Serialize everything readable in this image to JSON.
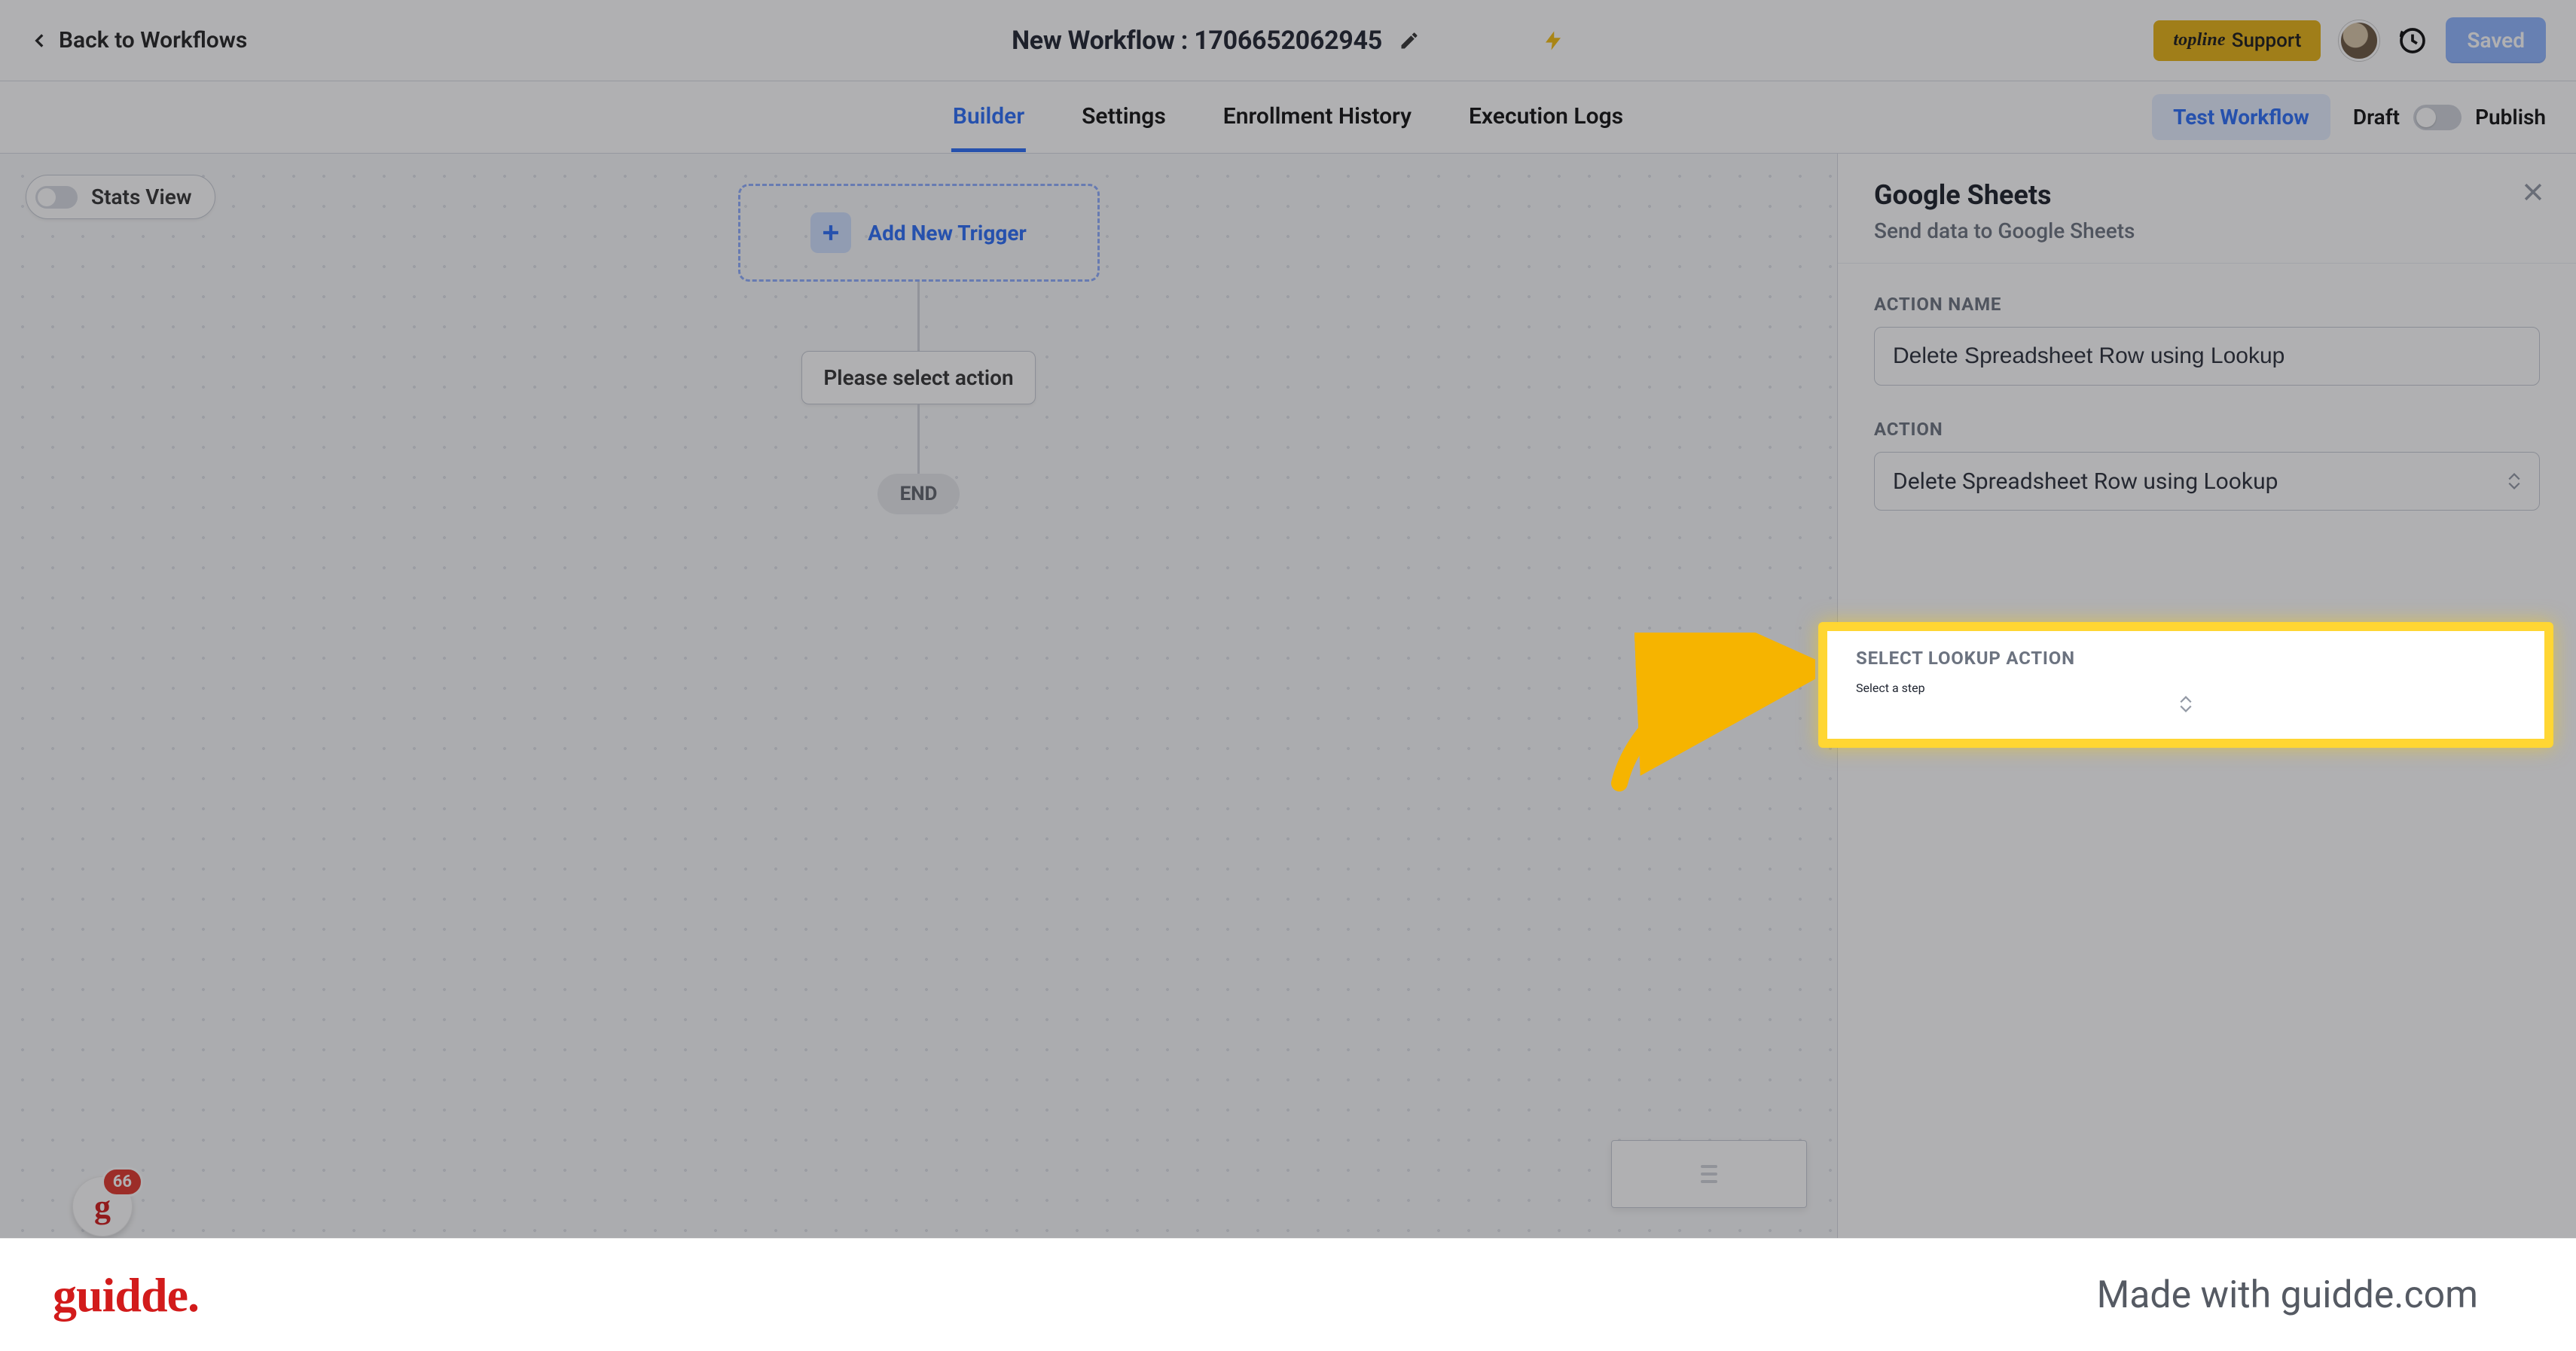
{
  "header": {
    "back_label": "Back to Workflows",
    "title": "New Workflow : 1706652062945",
    "support_brand": "topline",
    "support_label": "Support",
    "saved_label": "Saved"
  },
  "tabs": {
    "items": [
      "Builder",
      "Settings",
      "Enrollment History",
      "Execution Logs"
    ],
    "active_index": 0,
    "test_label": "Test Workflow",
    "draft_label": "Draft",
    "publish_label": "Publish"
  },
  "canvas": {
    "stats_view_label": "Stats View",
    "add_trigger_label": "Add New Trigger",
    "action_placeholder_label": "Please select action",
    "end_label": "END",
    "badge_count": "66"
  },
  "panel": {
    "title": "Google Sheets",
    "subtitle": "Send data to Google Sheets",
    "fields": {
      "action_name_label": "ACTION NAME",
      "action_name_value": "Delete Spreadsheet Row using Lookup",
      "action_label": "ACTION",
      "action_value": "Delete Spreadsheet Row using Lookup",
      "lookup_label": "SELECT LOOKUP ACTION",
      "lookup_placeholder": "Select a step"
    }
  },
  "footer": {
    "brand": "guidde.",
    "madewith": "Made with guidde.com"
  }
}
